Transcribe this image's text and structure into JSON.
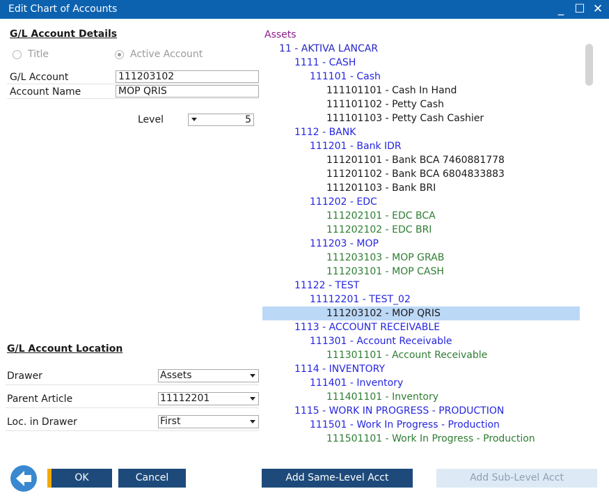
{
  "window": {
    "title": "Edit Chart of Accounts",
    "minimize_glyph": "_",
    "maximize_glyph": "☐",
    "close_glyph": "✕"
  },
  "details": {
    "heading": "G/L Account Details",
    "radio_title_label": "Title",
    "radio_active_label": "Active Account",
    "selected_radio": "Active Account",
    "gl_account_label": "G/L Account",
    "gl_account_value": "111203102",
    "account_name_label": "Account Name",
    "account_name_value": "MOP QRIS",
    "level_label": "Level",
    "level_value": "5"
  },
  "location": {
    "heading": "G/L Account Location",
    "drawer_label": "Drawer",
    "drawer_value": "Assets",
    "parent_label": "Parent Article",
    "parent_value": "11112201",
    "loc_label": "Loc. in Drawer",
    "loc_value": "First"
  },
  "tree": [
    {
      "text": "Assets",
      "level": 0,
      "color": "#8a1c8a"
    },
    {
      "text": "11 - AKTIVA LANCAR",
      "level": 1,
      "color": "#2525c4"
    },
    {
      "text": "1111 - CASH",
      "level": 2,
      "color": "#2525e0"
    },
    {
      "text": "111101 - Cash",
      "level": 3,
      "color": "#2525e0"
    },
    {
      "text": "111101101 - Cash In Hand",
      "level": 4,
      "color": "#1a1a1a"
    },
    {
      "text": "111101102 - Petty Cash",
      "level": 4,
      "color": "#1a1a1a"
    },
    {
      "text": "111101103 - Petty Cash Cashier",
      "level": 4,
      "color": "#1a1a1a"
    },
    {
      "text": "1112 - BANK",
      "level": 2,
      "color": "#2525e0"
    },
    {
      "text": "111201 - Bank IDR",
      "level": 3,
      "color": "#2525e0"
    },
    {
      "text": "111201101 - Bank BCA 7460881778",
      "level": 4,
      "color": "#1a1a1a"
    },
    {
      "text": "111201102 - Bank BCA 6804833883",
      "level": 4,
      "color": "#1a1a1a"
    },
    {
      "text": "111201103 - Bank BRI",
      "level": 4,
      "color": "#1a1a1a"
    },
    {
      "text": "111202 - EDC",
      "level": 3,
      "color": "#2525e0"
    },
    {
      "text": "111202101 - EDC BCA",
      "level": 4,
      "color": "#2e7d32"
    },
    {
      "text": "111202102 - EDC BRI",
      "level": 4,
      "color": "#2e7d32"
    },
    {
      "text": "111203 - MOP",
      "level": 3,
      "color": "#2525e0"
    },
    {
      "text": "111203103 - MOP GRAB",
      "level": 4,
      "color": "#2e7d32"
    },
    {
      "text": "111203101 - MOP CASH",
      "level": 4,
      "color": "#2e7d32"
    },
    {
      "text": "11122 - TEST",
      "level": 2,
      "color": "#2525e0"
    },
    {
      "text": "11112201 - TEST_02",
      "level": 3,
      "color": "#2525e0"
    },
    {
      "text": "111203102 - MOP QRIS",
      "level": 4,
      "color": "#1a1a1a",
      "selected": true
    },
    {
      "text": "1113 - ACCOUNT RECEIVABLE",
      "level": 2,
      "color": "#2525e0"
    },
    {
      "text": "111301 - Account Receivable",
      "level": 3,
      "color": "#2525e0"
    },
    {
      "text": "111301101 - Account Receivable",
      "level": 4,
      "color": "#2e7d32"
    },
    {
      "text": "1114 - INVENTORY",
      "level": 2,
      "color": "#2525e0"
    },
    {
      "text": "111401 - Inventory",
      "level": 3,
      "color": "#2525e0"
    },
    {
      "text": "111401101 - Inventory",
      "level": 4,
      "color": "#2e7d32"
    },
    {
      "text": "1115 - WORK IN PROGRESS - PRODUCTION",
      "level": 2,
      "color": "#2525e0"
    },
    {
      "text": "111501 - Work In Progress - Production",
      "level": 3,
      "color": "#2525e0"
    },
    {
      "text": "111501101 - Work In Progress - Production",
      "level": 4,
      "color": "#2e7d32"
    }
  ],
  "buttons": {
    "ok": "OK",
    "cancel": "Cancel",
    "add_same_level": "Add Same-Level Acct",
    "add_sub_level": "Add Sub-Level Acct"
  }
}
